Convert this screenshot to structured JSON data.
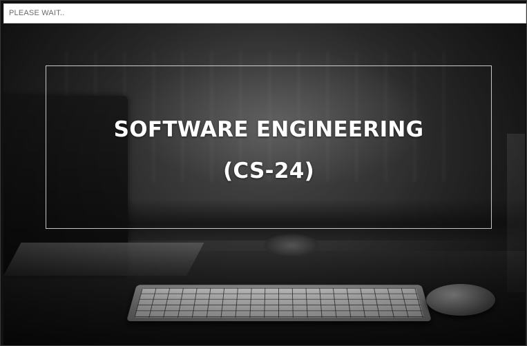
{
  "window": {
    "title": "PLEASE WAIT.."
  },
  "splash": {
    "heading": "SOFTWARE ENGINEERING",
    "subheading": "(CS-24)",
    "text_color": "#ffffff",
    "frame_color": "#e6e6e6"
  },
  "background_image": {
    "description_icon": "desk-keyboard-photo"
  }
}
